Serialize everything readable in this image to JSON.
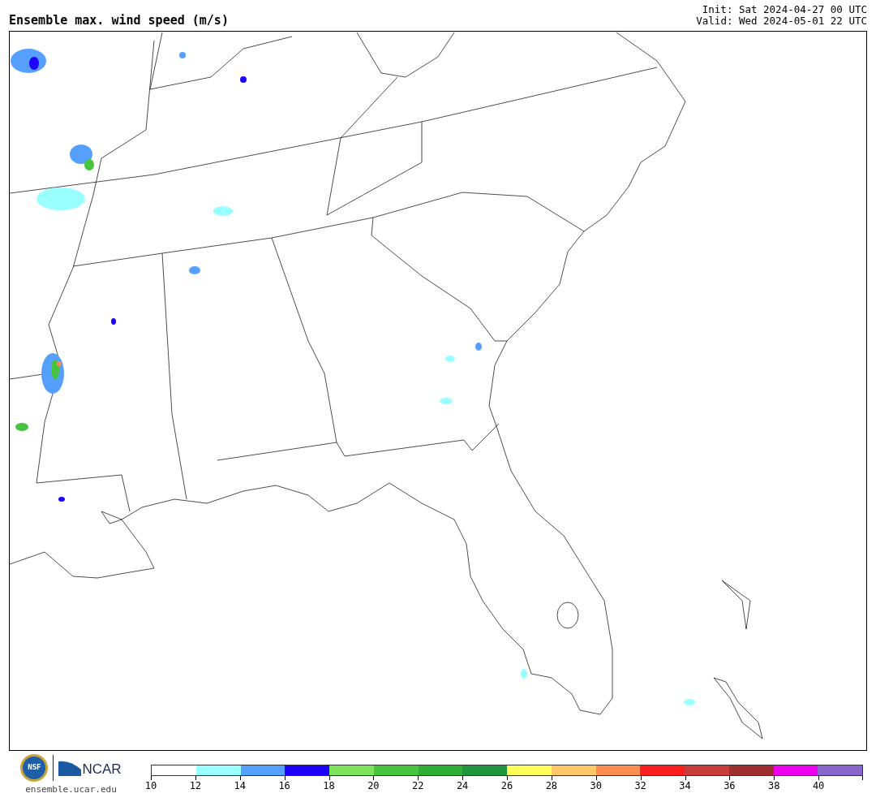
{
  "title": "Ensemble max. wind speed (m/s)",
  "init": "Init: Sat 2024-04-27 00 UTC",
  "valid": "Valid: Wed 2024-05-01 22 UTC",
  "nsf_logo": "NSF",
  "ncar_logo": "NCAR",
  "site": "ensemble.ucar.edu",
  "colorbar": {
    "segments": [
      {
        "color": "#ffffff"
      },
      {
        "color": "#99ffff"
      },
      {
        "color": "#55a0ff"
      },
      {
        "color": "#1e00ff"
      },
      {
        "color": "#7de35a"
      },
      {
        "color": "#46c43e"
      },
      {
        "color": "#2eb035"
      },
      {
        "color": "#1e963c"
      },
      {
        "color": "#ffff5a"
      },
      {
        "color": "#ffc864"
      },
      {
        "color": "#ff8c50"
      },
      {
        "color": "#ff1e1e"
      },
      {
        "color": "#c83c3c"
      },
      {
        "color": "#a02d2d"
      },
      {
        "color": "#ee00ee"
      },
      {
        "color": "#8866cc"
      }
    ],
    "ticks": [
      "10",
      "12",
      "14",
      "16",
      "18",
      "20",
      "22",
      "24",
      "26",
      "28",
      "30",
      "32",
      "34",
      "36",
      "38",
      "40"
    ]
  }
}
